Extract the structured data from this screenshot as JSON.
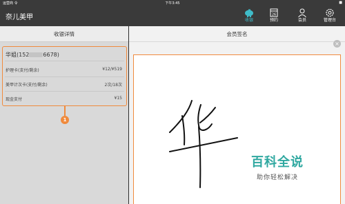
{
  "statusbar": {
    "carrier": "运营商 令",
    "time": "下午3:45",
    "battery": "■"
  },
  "topnav": {
    "brand": "奈儿美甲",
    "items": [
      {
        "label": "收银",
        "icon": "piggy-bank-icon",
        "active": true
      },
      {
        "label": "预约",
        "icon": "calendar-icon",
        "active": false
      },
      {
        "label": "会员",
        "icon": "person-icon",
        "active": false
      },
      {
        "label": "管理台",
        "icon": "gear-icon",
        "active": false
      }
    ],
    "accent": "#3fbcc9"
  },
  "left": {
    "title": "收银详情",
    "customer_prefix": "华姐(152",
    "customer_suffix": "6678)",
    "rows": [
      {
        "label": "护理卡(支付/剩余)",
        "value": "¥12/¥519"
      },
      {
        "label": "美甲计次卡(支付/剩余)",
        "value": "2次/18次"
      },
      {
        "label": "现金支付",
        "value": "¥15"
      }
    ],
    "callout_number": "1",
    "highlight_color": "#f08a3c"
  },
  "right": {
    "title": "会员签名",
    "close_symbol": "×"
  },
  "watermark": {
    "line1": "百科全说",
    "line2": "助你轻松解决"
  }
}
